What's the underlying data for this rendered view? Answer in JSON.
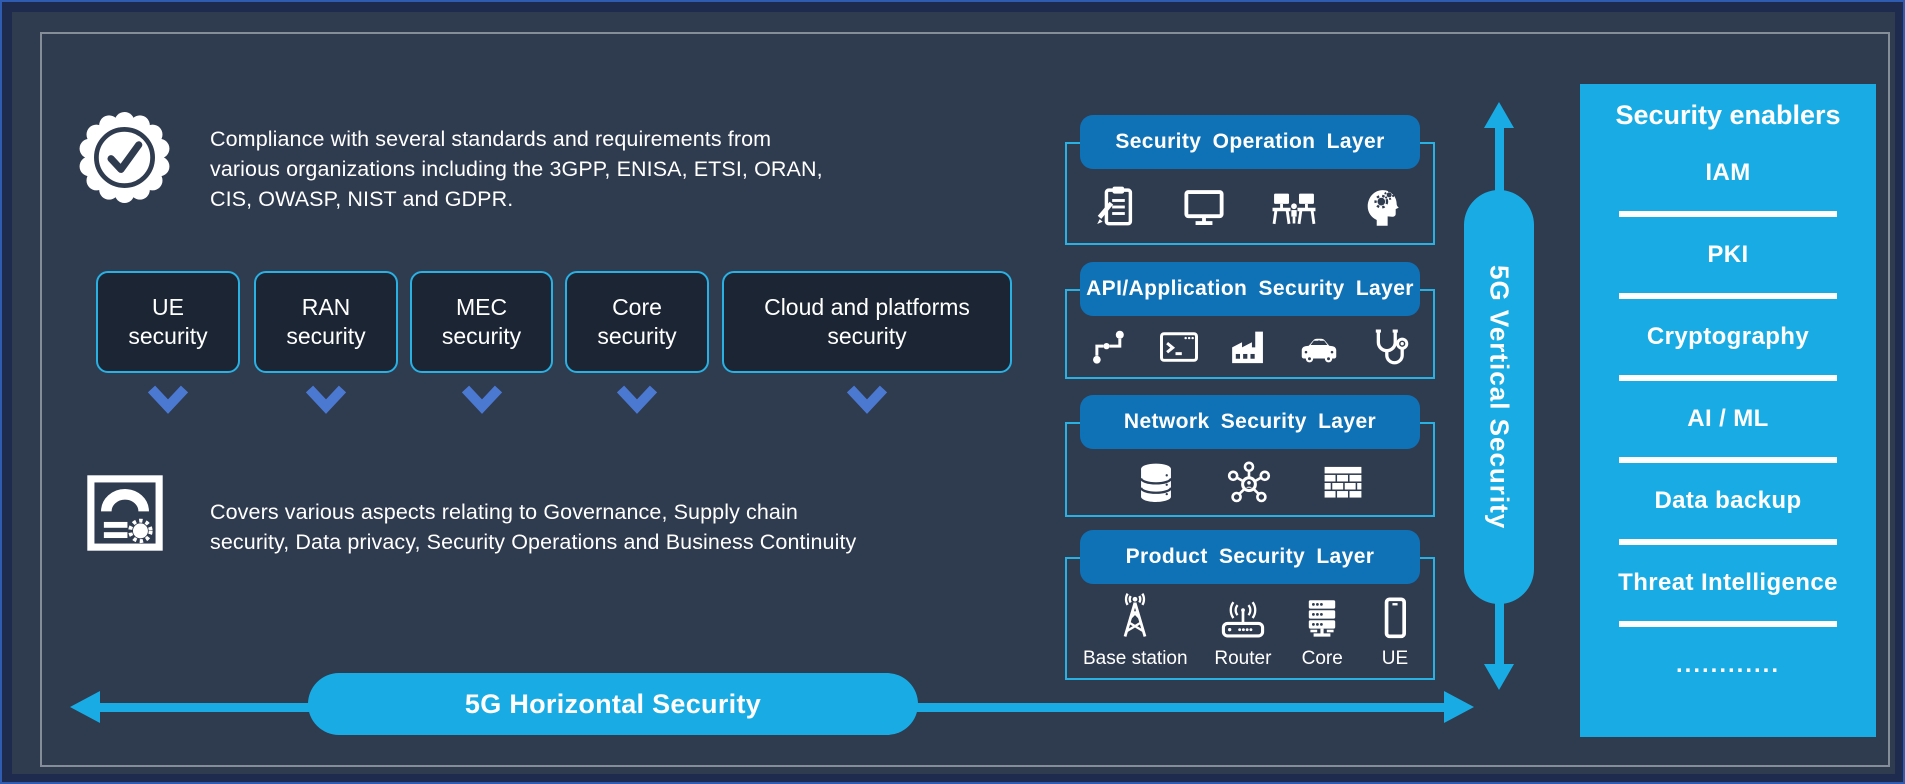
{
  "badge_section": {
    "text": "Compliance with several standards and requirements from\nvarious organizations including the 3GPP, ENISA, ETSI, ORAN,\nCIS, OWASP, NIST and GDPR."
  },
  "coverage_section": {
    "text": "Covers various aspects relating to Governance, Supply chain\nsecurity, Data privacy, Security Operations and Business Continuity"
  },
  "domain_boxes": [
    {
      "label": "UE security"
    },
    {
      "label": "RAN security"
    },
    {
      "label": "MEC security"
    },
    {
      "label": "Core security"
    },
    {
      "label": "Cloud and platforms security"
    }
  ],
  "arrows": {
    "horizontal_label": "5G Horizontal Security",
    "vertical_label": "5G Vertical Security"
  },
  "layers": [
    {
      "title": "Security Operation Layer",
      "icons": [
        {
          "name": "clipboard-pencil-icon"
        },
        {
          "name": "monitor-icon"
        },
        {
          "name": "operations-desk-icon"
        },
        {
          "name": "head-gears-icon"
        }
      ]
    },
    {
      "title": "API/Application Security Layer",
      "icons": [
        {
          "name": "workflow-nodes-icon"
        },
        {
          "name": "terminal-icon"
        },
        {
          "name": "factory-icon"
        },
        {
          "name": "car-icon"
        },
        {
          "name": "stethoscope-icon"
        }
      ]
    },
    {
      "title": "Network Security Layer",
      "icons": [
        {
          "name": "database-icon"
        },
        {
          "name": "user-network-icon"
        },
        {
          "name": "firewall-icon"
        }
      ]
    },
    {
      "title": "Product Security Layer",
      "icons": [
        {
          "name": "base-station-icon",
          "label": "Base station"
        },
        {
          "name": "router-icon",
          "label": "Router"
        },
        {
          "name": "core-server-icon",
          "label": "Core"
        },
        {
          "name": "smartphone-icon",
          "label": "UE"
        }
      ]
    }
  ],
  "enablers": {
    "title": "Security enablers",
    "items": [
      "IAM",
      "PKI",
      "Cryptography",
      "AI / ML",
      "Data backup",
      "Threat Intelligence",
      "............"
    ]
  },
  "colors": {
    "accent_cyan": "#19ace4",
    "layer_header_blue": "#0f72b6",
    "chevron_blue": "#4b79d2",
    "background_slate": "#2f3b4f",
    "box_fill": "#1c2533",
    "outer_navy": "#1f2b4e",
    "frame_gray": "#858d99"
  }
}
